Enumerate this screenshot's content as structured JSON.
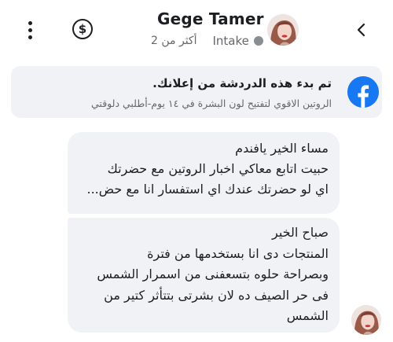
{
  "header": {
    "contact_name": "Gege Tamer",
    "last_active": "أكثر من 2",
    "label": "Intake",
    "icons": {
      "menu": "more-vertical-icon",
      "payment": "dollar-circle-icon",
      "back": "chevron-right-icon",
      "status": "offline-status-dot"
    }
  },
  "ad_context": {
    "title": "تم بدء هذه الدردشة من إعلانك.",
    "subtitle": "الروتين الاقوي لتفتيح لون البشرة في ١٤ يوم-أطلبي دلوقتي",
    "icon": "facebook-logo-icon",
    "brand_color": "#1877f2"
  },
  "messages": [
    {
      "lines": [
        "مساء الخير يافندم",
        "حبيت اتابع معاكي اخبار الروتين مع حضرتك",
        "اي لو حضرتك عندك اي استفسار انا مع حض..."
      ]
    },
    {
      "lines": [
        "صباح الخير",
        "المنتجات دى انا بستخدمها من فترة",
        "وبصراحة حلوه بتسعفنى من اسمرار الشمس",
        "فى حر الصيف ده لان بشرتى بتتأثر كتير من",
        "الشمس"
      ]
    }
  ],
  "colors": {
    "bubble_background": "#f0f2f5",
    "text_primary": "#1c1e21",
    "text_secondary": "#65676b"
  }
}
